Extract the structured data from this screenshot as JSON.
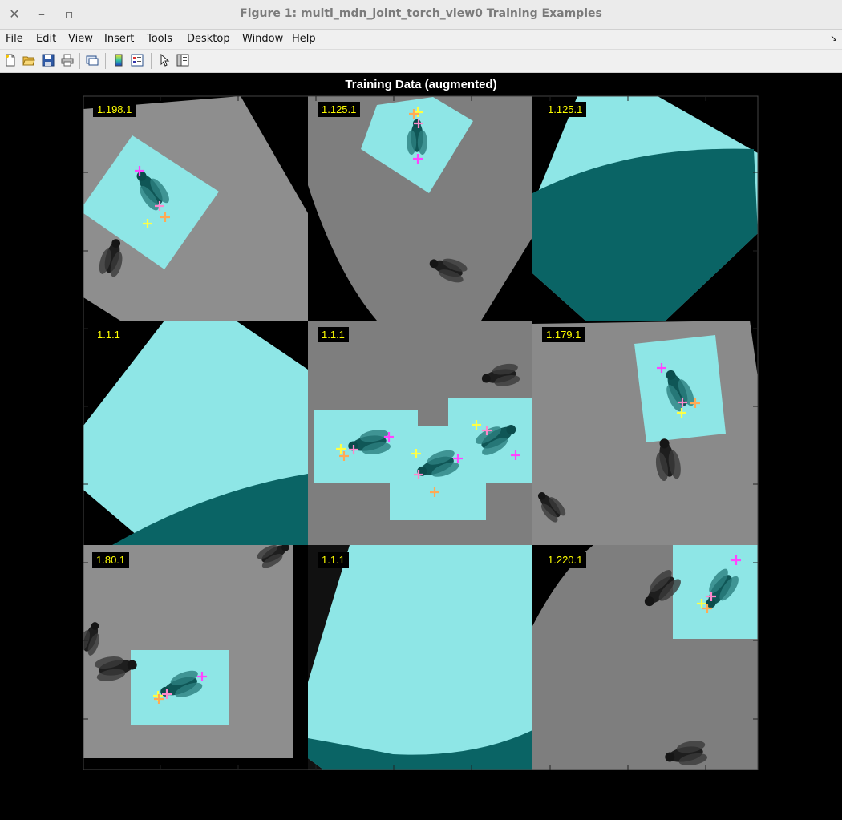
{
  "window": {
    "title": "Figure 1: multi_mdn_joint_torch_view0 Training Examples",
    "close_glyph": "✕",
    "minimize_glyph": "–",
    "maximize_glyph": "▫"
  },
  "menu": {
    "items": [
      {
        "label": "File"
      },
      {
        "label": "Edit"
      },
      {
        "label": "View"
      },
      {
        "label": "Insert"
      },
      {
        "label": "Tools"
      },
      {
        "label": "Desktop"
      },
      {
        "label": "Window"
      },
      {
        "label": "Help"
      }
    ],
    "dock_glyph": "↘"
  },
  "toolbar": {
    "icons": [
      "new-figure-icon",
      "open-icon",
      "save-icon",
      "print-icon",
      "link-icon",
      "colorbar-icon",
      "legend-icon",
      "pointer-icon",
      "property-editor-icon"
    ]
  },
  "figure": {
    "title": "Training Data (augmented)",
    "tiles": [
      {
        "label": "1.198.1"
      },
      {
        "label": "1.125.1"
      },
      {
        "label": "1.125.1"
      },
      {
        "label": "1.1.1"
      },
      {
        "label": "1.1.1"
      },
      {
        "label": "1.179.1"
      },
      {
        "label": "1.80.1"
      },
      {
        "label": "1.1.1"
      },
      {
        "label": "1.220.1"
      }
    ]
  },
  "colors": {
    "mask": "#8ee6e6",
    "mask_dark": "#0a6465",
    "kp_magenta": "#ff44ff",
    "kp_pink": "#ff88cc",
    "kp_orange": "#ffaa55",
    "kp_yellow": "#ffff44"
  }
}
